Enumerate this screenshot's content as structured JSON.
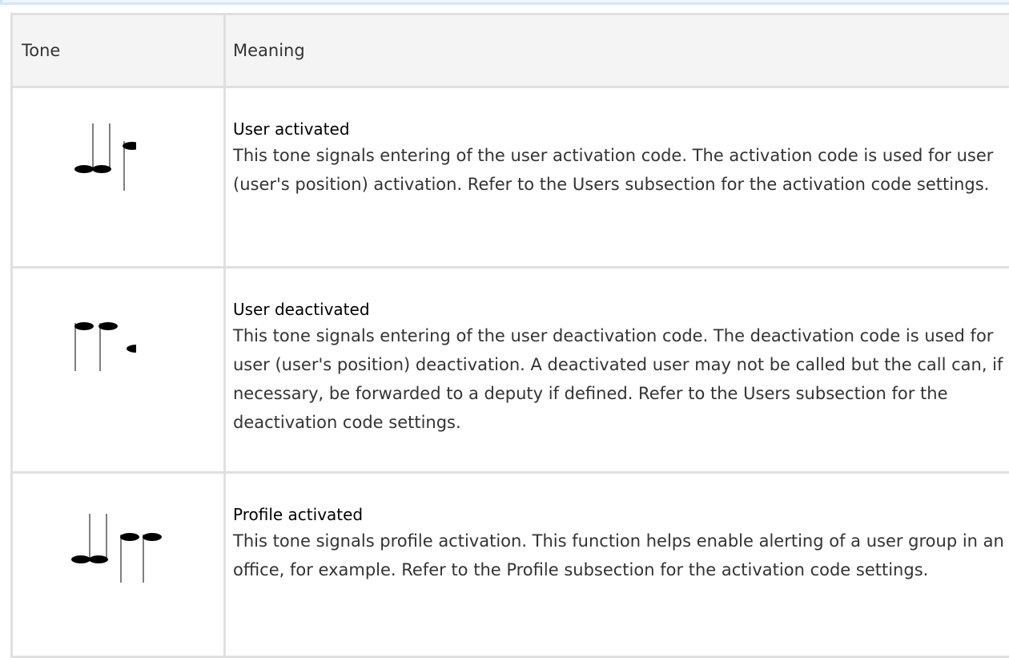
{
  "table": {
    "headers": {
      "tone": "Tone",
      "meaning": "Meaning"
    },
    "rows": [
      {
        "icon": "user-activated-tone-icon",
        "title": "User activated",
        "description": "This tone signals entering of the user activation code. The activation code is used for user (user's position) activation. Refer to the Users subsection for the activation code settings."
      },
      {
        "icon": "user-deactivated-tone-icon",
        "title": "User deactivated",
        "description": "This tone signals entering of the user deactivation code. The deactivation code is used for user (user's position) deactivation. A deactivated user may not be called but the call can, if necessary, be forwarded to a deputy if defined. Refer to the Users subsection for the deactivation code settings."
      },
      {
        "icon": "profile-activated-tone-icon",
        "title": "Profile activated",
        "description": "This tone signals profile activation. This function helps enable alerting of a user group in an office, for example. Refer to the Profile subsection for the activation code settings."
      }
    ]
  }
}
